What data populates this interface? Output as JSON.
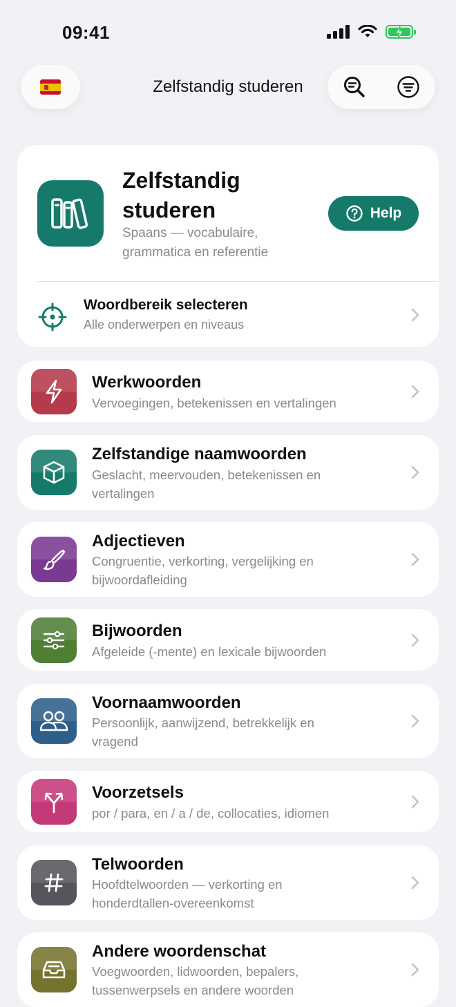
{
  "status_bar": {
    "time": "09:41"
  },
  "nav": {
    "title": "Zelfstandig studeren"
  },
  "hero": {
    "title": "Zelfstandig studeren",
    "subtitle": "Spaans — vocabulaire, grammatica en referentie",
    "help_label": "Help",
    "scope_title": "Woordbereik selecteren",
    "scope_subtitle": "Alle onderwerpen en niveaus"
  },
  "categories": [
    {
      "title": "Werkwoorden",
      "subtitle": "Vervoegingen, betekenissen en vertalingen",
      "icon": "bolt-icon",
      "color": "#b53a4b"
    },
    {
      "title": "Zelfstandige naamwoorden",
      "subtitle": "Geslacht, meervouden, betekenissen en vertalingen",
      "icon": "cube-icon",
      "color": "#167a6a"
    },
    {
      "title": "Adjectieven",
      "subtitle": "Congruentie, verkorting, vergelijking en bijwoordafleiding",
      "icon": "paintbrush-icon",
      "color": "#7b3a92"
    },
    {
      "title": "Bijwoorden",
      "subtitle": "Afgeleide (-mente) en lexicale bijwoorden",
      "icon": "sliders-icon",
      "color": "#4f7f35"
    },
    {
      "title": "Voornaamwoorden",
      "subtitle": "Persoonlijk, aanwijzend, betrekkelijk en vragend",
      "icon": "people-icon",
      "color": "#2e5f8a"
    },
    {
      "title": "Voorzetsels",
      "subtitle": "por / para, en / a / de, collocaties, idiomen",
      "icon": "split-arrow-icon",
      "color": "#c43a78"
    },
    {
      "title": "Telwoorden",
      "subtitle": "Hoofdtelwoorden — verkorting en honderdtallen-overeenkomst",
      "icon": "hashtag-icon",
      "color": "#55555c"
    },
    {
      "title": "Andere woordenschat",
      "subtitle": "Voegwoorden, lidwoorden, bepalers, tussenwerpsels en andere woorden",
      "icon": "tray-icon",
      "color": "#76732e"
    }
  ]
}
